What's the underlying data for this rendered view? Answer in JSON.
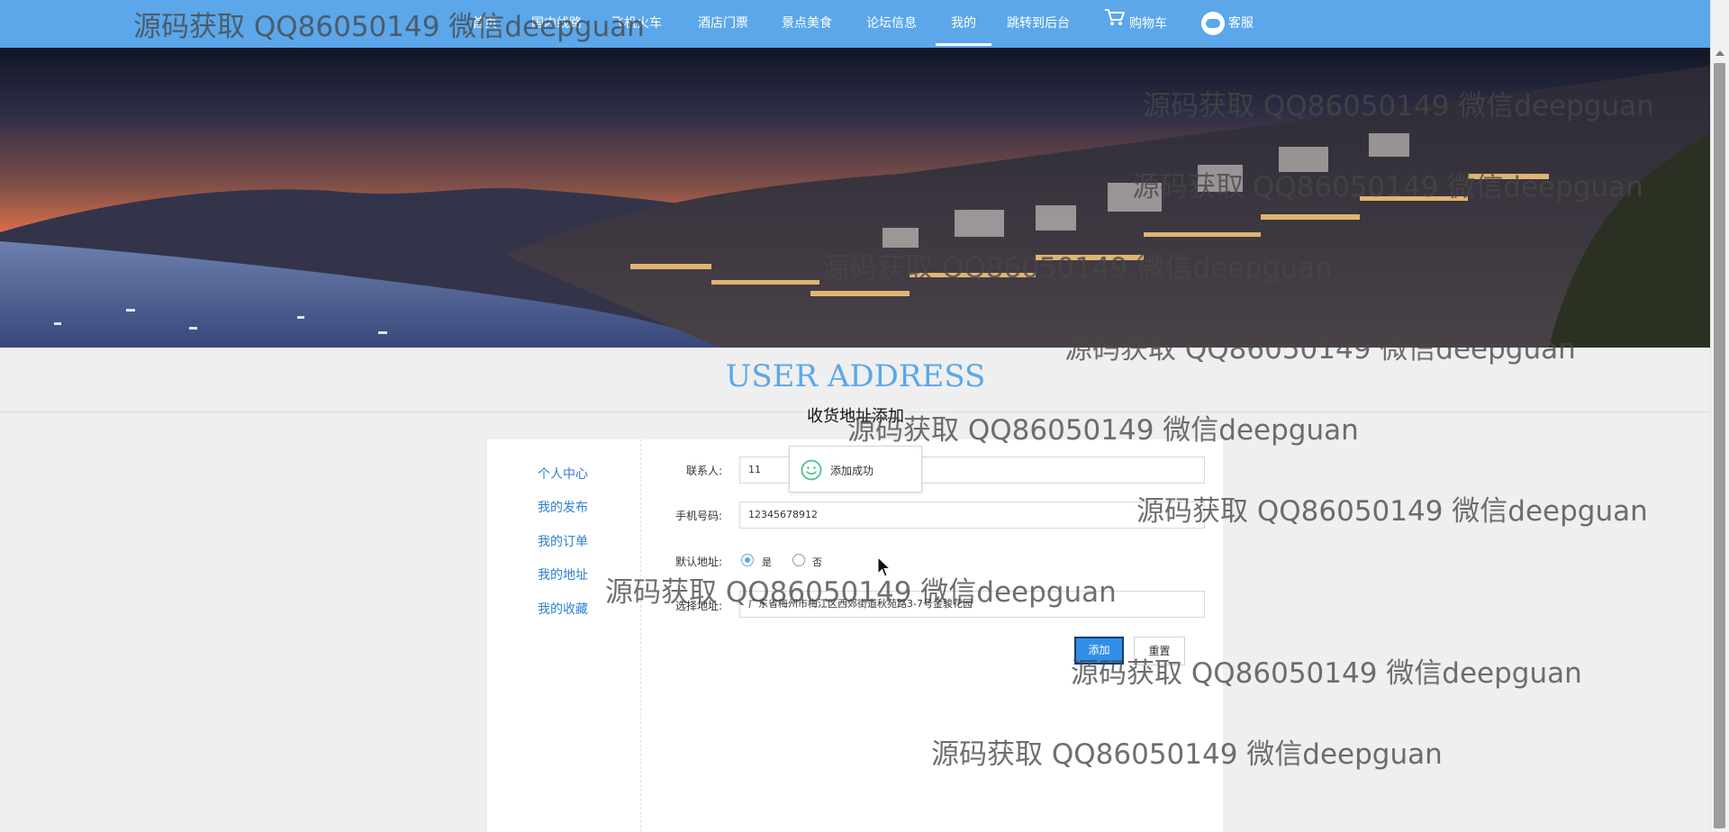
{
  "nav": {
    "items": [
      {
        "label": "首页"
      },
      {
        "label": "国内线路"
      },
      {
        "label": "飞机火车"
      },
      {
        "label": "酒店门票"
      },
      {
        "label": "景点美食"
      },
      {
        "label": "论坛信息"
      },
      {
        "label": "我的",
        "active": true
      },
      {
        "label": "跳转到后台"
      },
      {
        "label": "购物车",
        "icon": "shopping-cart-icon"
      },
      {
        "label": "客服",
        "icon": "customer-service-icon"
      }
    ]
  },
  "page": {
    "title": "USER ADDRESS",
    "subtitle": "收货地址添加"
  },
  "sidebar": {
    "items": [
      {
        "label": "个人中心"
      },
      {
        "label": "我的发布"
      },
      {
        "label": "我的订单"
      },
      {
        "label": "我的地址"
      },
      {
        "label": "我的收藏"
      }
    ]
  },
  "form": {
    "contact_label": "联系人:",
    "contact_value": "11",
    "phone_label": "手机号码:",
    "phone_value": "12345678912",
    "default_label": "默认地址:",
    "default_yes": "是",
    "default_no": "否",
    "default_selected": "是",
    "address_label": "选择地址:",
    "address_value": "广东省梅州市梅江区西郊街道秋苑路3-7号金骏花园",
    "add_button": "添加",
    "reset_button": "重置"
  },
  "toast": {
    "message": "添加成功",
    "icon": "smile-icon"
  },
  "watermark": "源码获取 QQ86050149 微信deepguan",
  "colors": {
    "nav_bg": "#5ba7ea",
    "accent": "#5ba7ea",
    "link": "#2f7fcf",
    "button": "#2f8fe8",
    "toast_icon": "#4cc28a"
  }
}
